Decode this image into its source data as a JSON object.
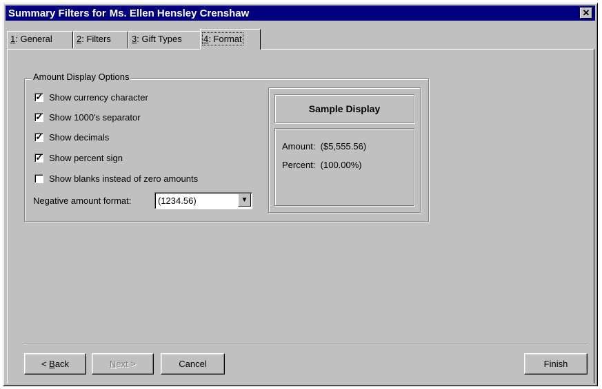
{
  "window": {
    "title_prefix": "Summary Filters for",
    "title_name": "Ms. Ellen Hensley Crenshaw",
    "close_glyph": "✕"
  },
  "tabs": [
    {
      "num": "1",
      "label": ": General"
    },
    {
      "num": "2",
      "label": ": Filters"
    },
    {
      "num": "3",
      "label": ": Gift Types"
    },
    {
      "num": "4",
      "label": ": Format"
    }
  ],
  "amount_display": {
    "legend": "Amount Display Options",
    "options": [
      {
        "label": "Show currency character",
        "checked": true
      },
      {
        "label": "Show 1000's separator",
        "checked": true
      },
      {
        "label": "Show decimals",
        "checked": true
      },
      {
        "label": "Show percent sign",
        "checked": true
      },
      {
        "label": "Show blanks instead of zero amounts",
        "checked": false
      }
    ],
    "negative_label": "Negative amount format:",
    "negative_value": "(1234.56)"
  },
  "sample": {
    "header": "Sample Display",
    "amount_label": "Amount:",
    "amount_value": "($5,555.56)",
    "percent_label": "Percent:",
    "percent_value": "(100.00%)"
  },
  "buttons": {
    "back_mark": "< ",
    "back_ul": "B",
    "back_rest": "ack",
    "next_ul": "N",
    "next_rest": "ext >",
    "cancel": "Cancel",
    "finish": "Finish"
  },
  "glyphs": {
    "check": "✓",
    "arrow": "▼"
  }
}
